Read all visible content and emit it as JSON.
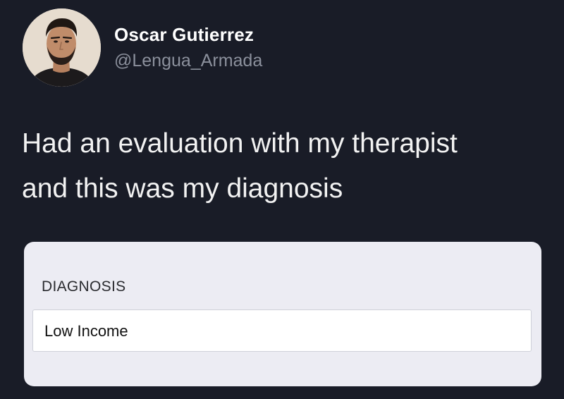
{
  "user": {
    "display_name": "Oscar Gutierrez",
    "handle": "@Lengua_Armada"
  },
  "tweet": {
    "text_line1": "Had an evaluation with my therapist",
    "text_line2": "and this was my diagnosis"
  },
  "card": {
    "label": "DIAGNOSIS",
    "value": "Low Income"
  },
  "colors": {
    "background": "#191c27",
    "handle": "#8b909c",
    "card_background": "#ececf3",
    "field_background": "#ffffff"
  },
  "icons": {
    "avatar": "profile-photo"
  }
}
